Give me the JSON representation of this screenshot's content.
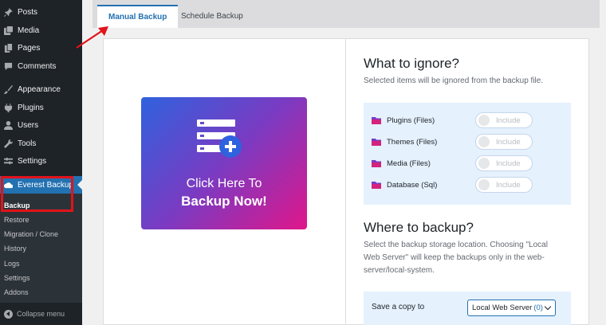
{
  "sidebar": {
    "items": [
      {
        "label": "Posts",
        "icon": "pin-icon"
      },
      {
        "label": "Media",
        "icon": "media-icon"
      },
      {
        "label": "Pages",
        "icon": "pages-icon"
      },
      {
        "label": "Comments",
        "icon": "comments-icon"
      },
      {
        "label": "Appearance",
        "icon": "brush-icon"
      },
      {
        "label": "Plugins",
        "icon": "plugin-icon"
      },
      {
        "label": "Users",
        "icon": "users-icon"
      },
      {
        "label": "Tools",
        "icon": "wrench-icon"
      },
      {
        "label": "Settings",
        "icon": "settings-icon"
      }
    ],
    "active": {
      "label": "Everest Backup",
      "icon": "cloud-dashboard-icon"
    },
    "submenu": [
      "Backup",
      "Restore",
      "Migration / Clone",
      "History",
      "Logs",
      "Settings",
      "Addons"
    ],
    "current_submenu": "Backup",
    "collapse_label": "Collapse menu"
  },
  "tabs": {
    "manual": "Manual Backup",
    "schedule": "Schedule Backup",
    "active": "Manual Backup"
  },
  "backup_card": {
    "line1": "Click Here To",
    "line2": "Backup Now!"
  },
  "ignore": {
    "title": "What to ignore?",
    "description": "Selected items will be ignored from the backup file.",
    "rows": [
      {
        "label": "Plugins (Files)",
        "toggle": "Include"
      },
      {
        "label": "Themes (Files)",
        "toggle": "Include"
      },
      {
        "label": "Media (Files)",
        "toggle": "Include"
      },
      {
        "label": "Database (Sql)",
        "toggle": "Include"
      }
    ]
  },
  "where": {
    "title": "Where to backup?",
    "description": "Select the backup storage location. Choosing \"Local Web Server\" will keep the backups only in the web-server/local-system.",
    "save_label": "Save a copy to",
    "select_value": "Local Web Server",
    "select_count": "(0)"
  },
  "colors": {
    "sidebar_bg": "#1d2327",
    "accent": "#2271b1",
    "highlight_red": "#e2131a",
    "folder": "#7a3bc2"
  }
}
